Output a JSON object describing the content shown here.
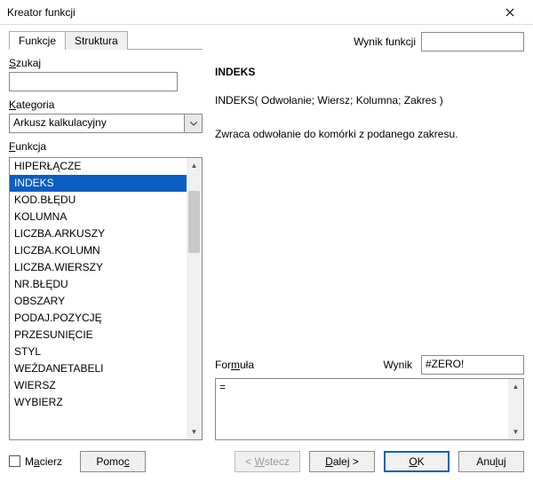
{
  "window": {
    "title": "Kreator funkcji"
  },
  "tabs": {
    "functions": "Funkcje",
    "structure": "Struktura"
  },
  "left": {
    "search_label": "Szukaj",
    "search_value": "",
    "category_label": "Kategoria",
    "category_value": "Arkusz kalkulacyjny",
    "function_label": "Funkcja",
    "functions": [
      "HIPERŁĄCZE",
      "INDEKS",
      "KOD.BŁĘDU",
      "KOLUMNA",
      "LICZBA.ARKUSZY",
      "LICZBA.KOLUMN",
      "LICZBA.WIERSZY",
      "NR.BŁĘDU",
      "OBSZARY",
      "PODAJ.POZYCJĘ",
      "PRZESUNIĘCIE",
      "STYL",
      "WEŹDANETABELI",
      "WIERSZ",
      "WYBIERZ"
    ],
    "selected_index": 1
  },
  "right": {
    "result_label": "Wynik funkcji",
    "result_value": "",
    "func_name": "INDEKS",
    "func_sig": "INDEKS( Odwołanie; Wiersz; Kolumna; Zakres )",
    "func_desc": "Zwraca odwołanie do komórki z podanego zakresu.",
    "formula_label": "Formuła",
    "wynik_label": "Wynik",
    "wynik_value": "#ZERO!",
    "formula_value": "="
  },
  "footer": {
    "matrix_label": "Macierz",
    "help": "Pomoc",
    "back": "< Wstecz",
    "next": "Dalej >",
    "ok": "OK",
    "cancel": "Anuluj"
  }
}
